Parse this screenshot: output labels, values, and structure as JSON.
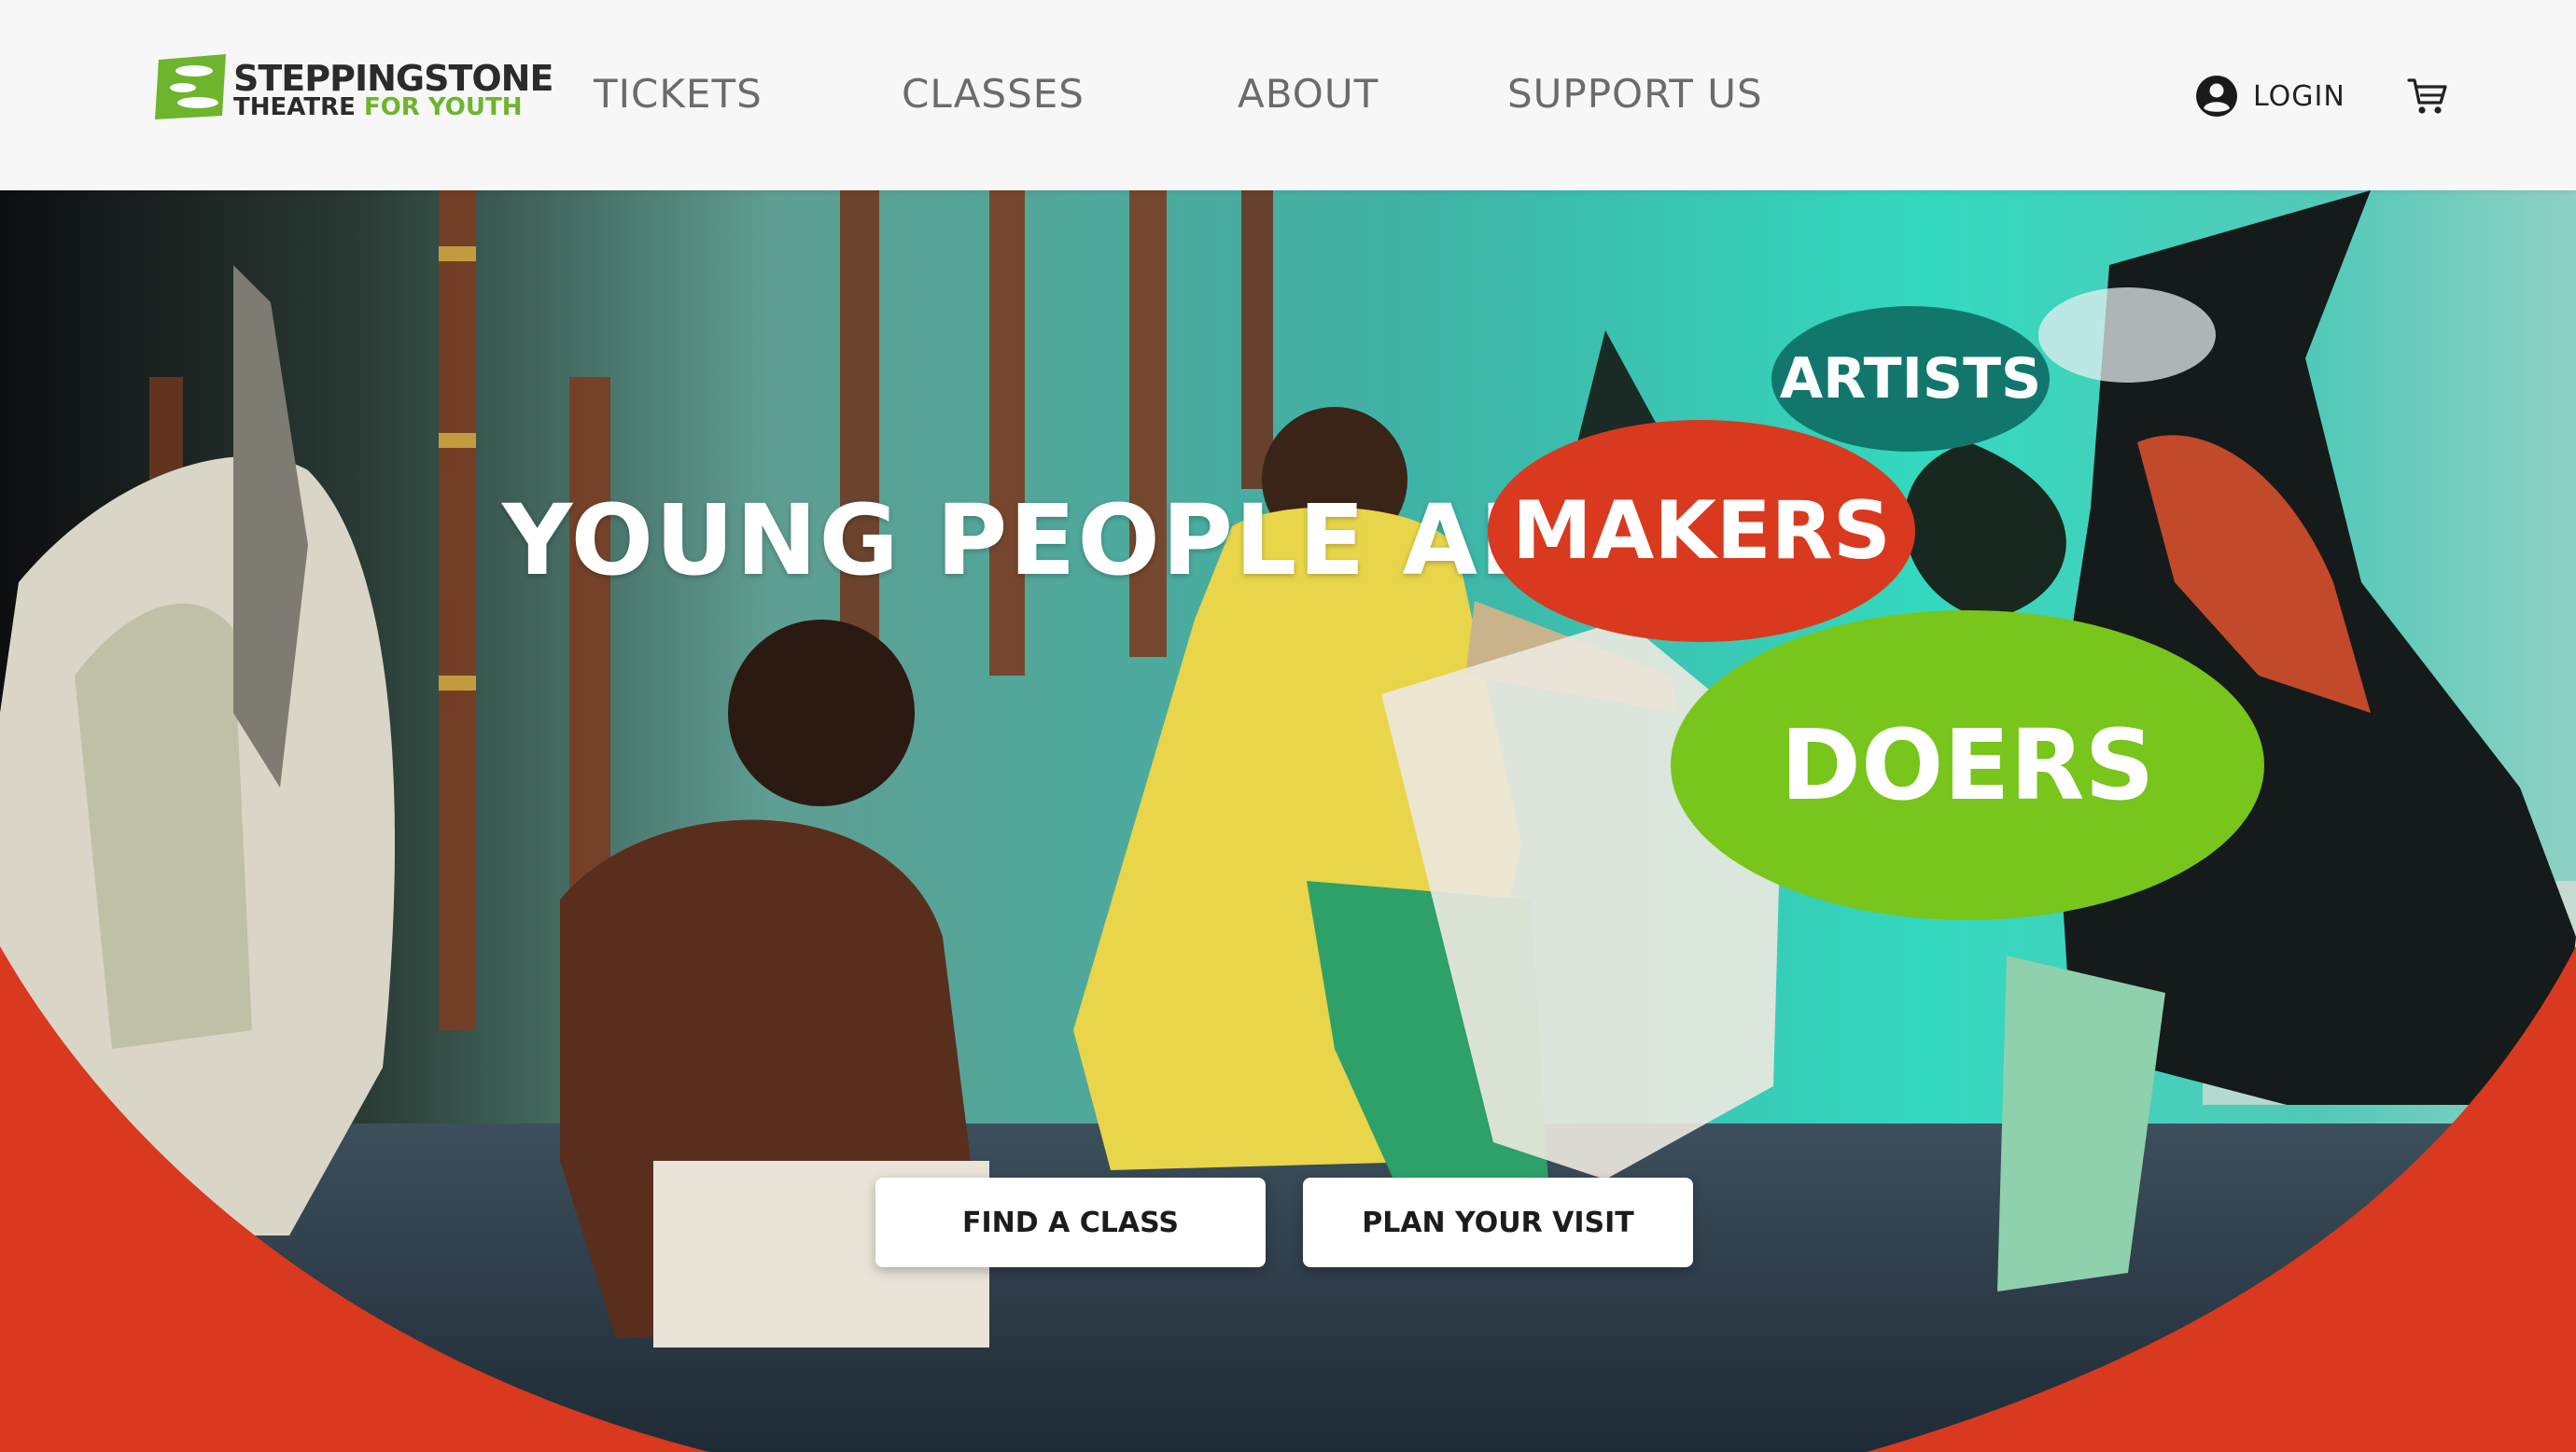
{
  "brand": {
    "name_line1": "STEPPINGSTONE",
    "name_line2_part1": "THEATRE ",
    "name_line2_part2": "FOR YOUTH",
    "logo_color": "#6cb52d"
  },
  "nav": {
    "items": [
      {
        "label": "TICKETS"
      },
      {
        "label": "CLASSES"
      },
      {
        "label": "ABOUT"
      },
      {
        "label": "SUPPORT US"
      }
    ],
    "login_label": "LOGIN",
    "login_icon": "account-circle-icon",
    "cart_icon": "shopping-cart-icon"
  },
  "hero": {
    "headline": "YOUNG PEOPLE ARE",
    "bubbles": [
      {
        "label": "ARTISTS",
        "color": "#11776d"
      },
      {
        "label": "MAKERS",
        "color": "#d9391e"
      },
      {
        "label": "DOERS",
        "color": "#78c51b"
      }
    ],
    "accent_color": "#d9391e",
    "buttons": [
      {
        "label": "FIND A CLASS"
      },
      {
        "label": "PLAN YOUR VISIT"
      }
    ]
  }
}
